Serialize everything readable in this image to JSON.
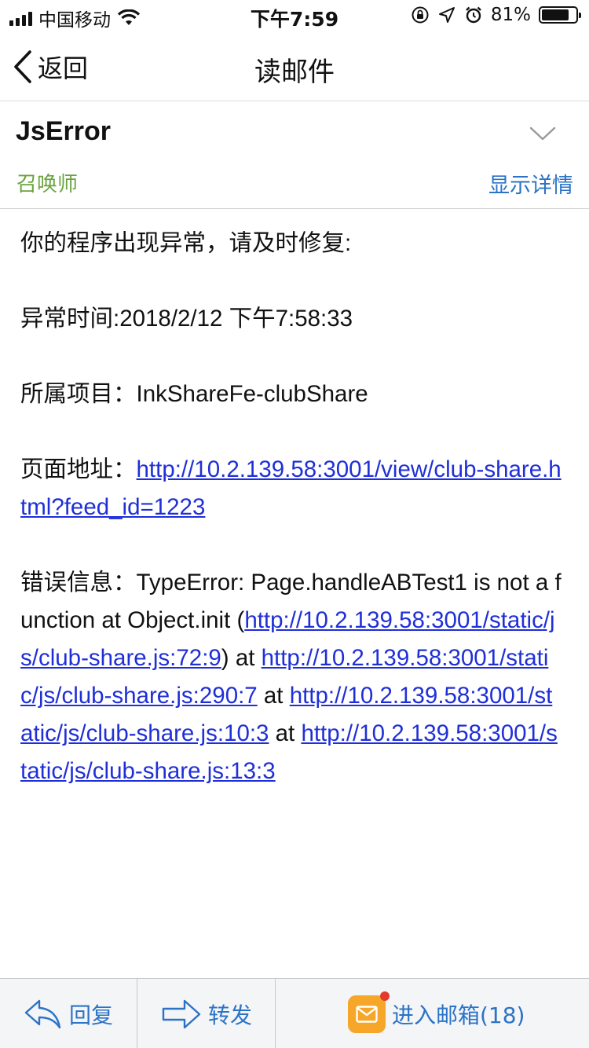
{
  "status_bar": {
    "carrier": "中国移动",
    "time": "下午7:59",
    "battery_percent": "81%",
    "battery_level": 0.81,
    "icons": [
      "signal-icon",
      "wifi-icon",
      "orientation-lock-icon",
      "location-icon",
      "alarm-icon",
      "battery-icon"
    ]
  },
  "nav": {
    "back_label": "返回",
    "title": "读邮件"
  },
  "mail": {
    "subject": "JsError",
    "sender": "召唤师",
    "details_label": "显示详情",
    "sender_color": "#6aa33e",
    "link_color": "#1f2fd8",
    "body": {
      "intro": "你的程序出现异常，请及时修复:",
      "time_line": "异常时间:2018/2/12 下午7:58:33",
      "project_label": "所属项目：",
      "project_value": "InkShareFe-clubShare",
      "page_label": "页面地址：",
      "page_url": "http://10.2.139.58:3001/view/club-share.html?feed_id=1223",
      "error_label": "错误信息：",
      "error_text_1": "TypeError: Page.handleABTest1 is not a function at Object.init (",
      "error_url_1": "http://10.2.139.58:3001/static/js/club-share.js:72:9",
      "error_text_2": ") at ",
      "error_url_2": "http://10.2.139.58:3001/static/js/club-share.js:290:7",
      "error_text_3": " at ",
      "error_url_3": "http://10.2.139.58:3001/static/js/club-share.js:10:3",
      "error_text_4": " at ",
      "error_url_4": "http://10.2.139.58:3001/static/js/club-share.js:13:3"
    }
  },
  "toolbar": {
    "reply_label": "回复",
    "forward_label": "转发",
    "inbox_label": "进入邮箱(18)",
    "accent_color": "#2b73c6"
  }
}
